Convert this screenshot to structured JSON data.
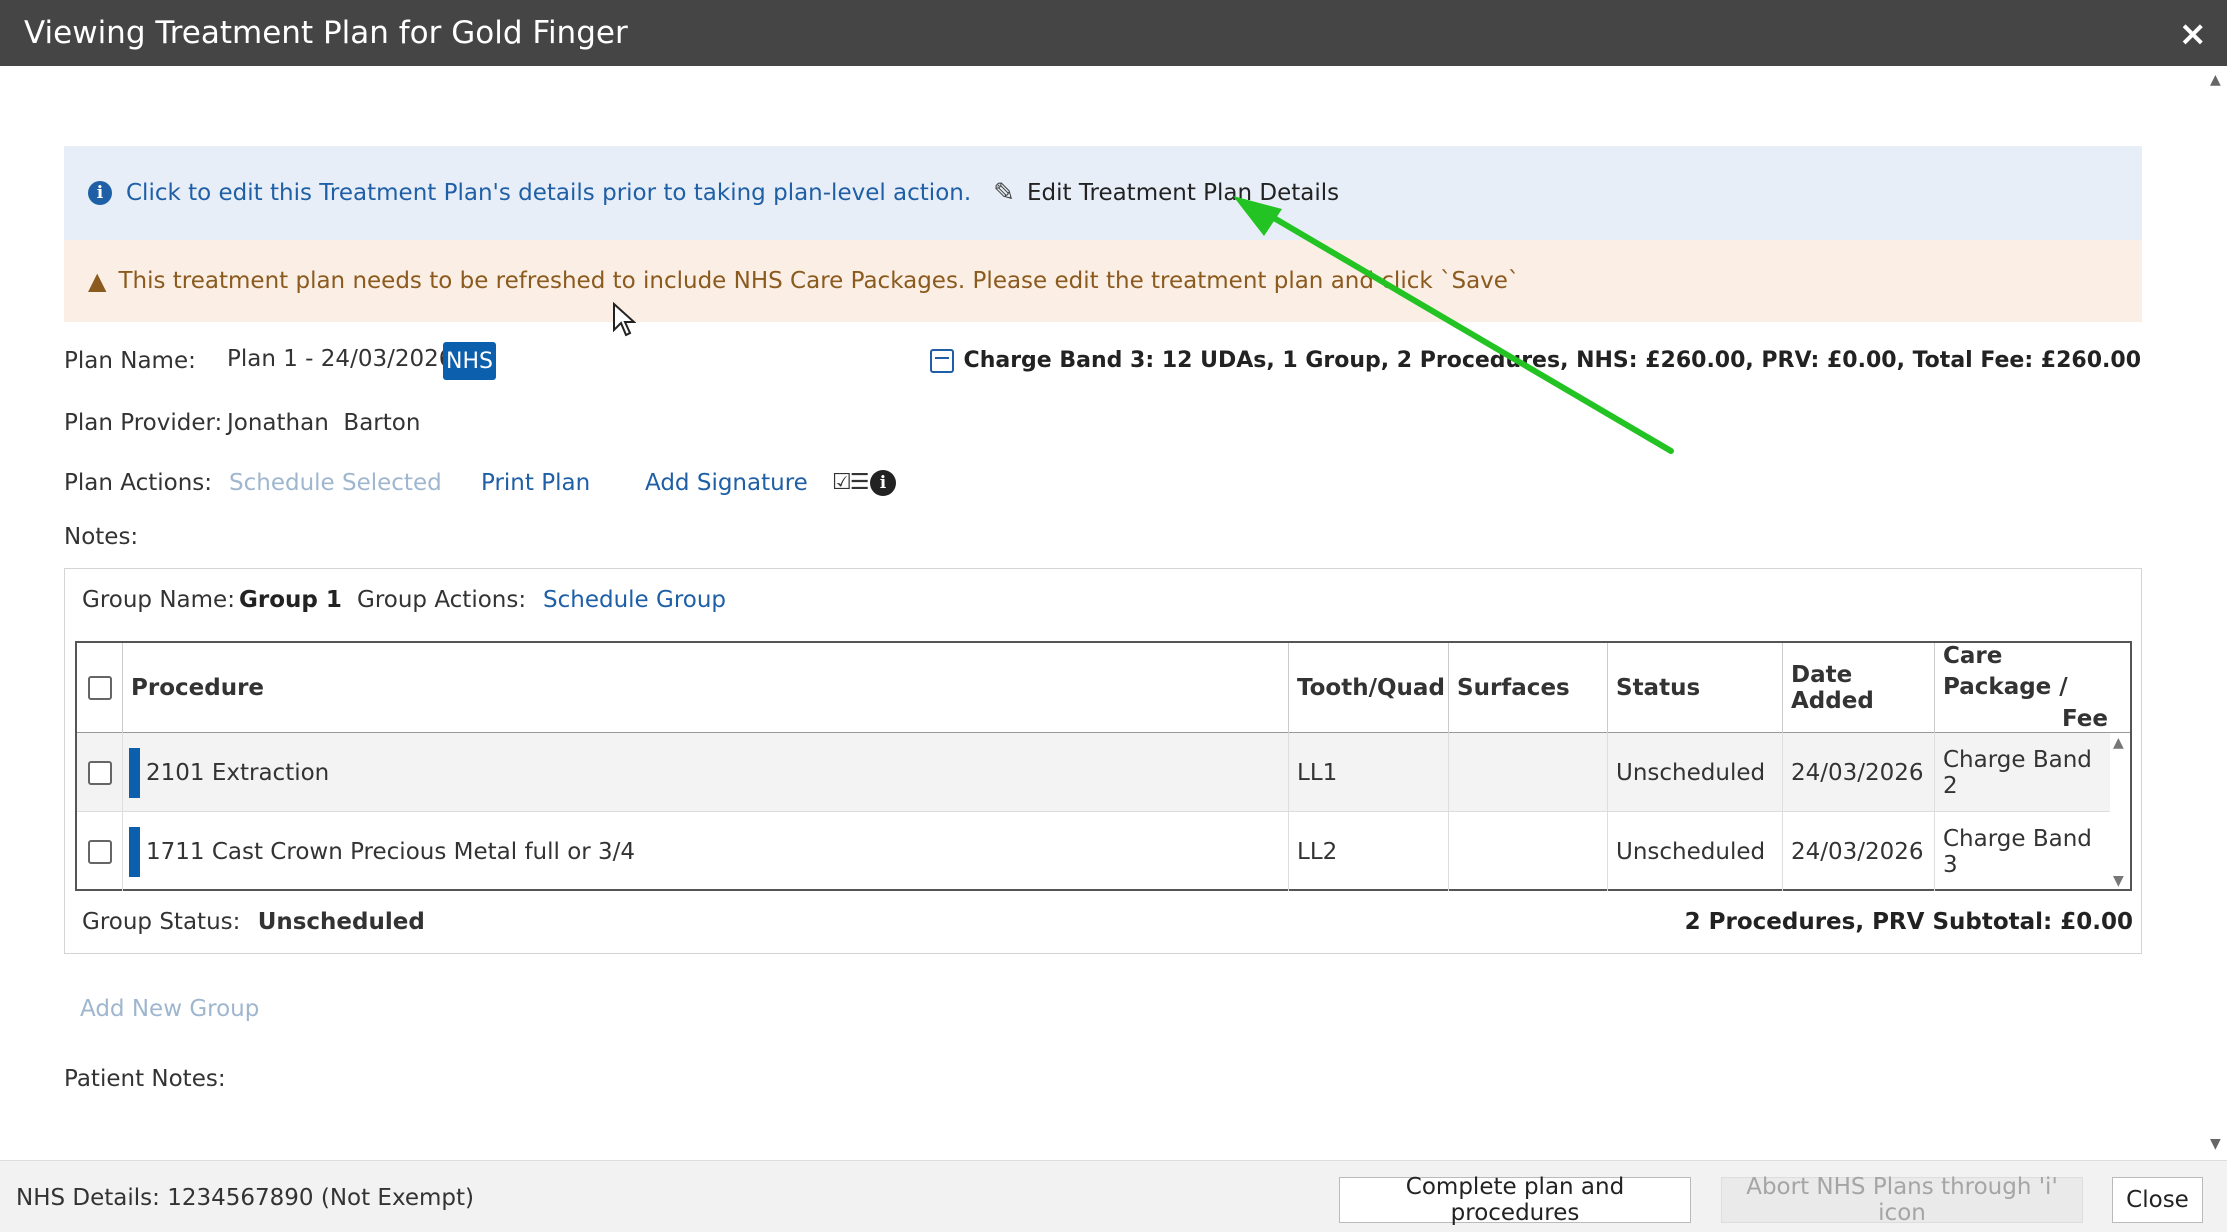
{
  "window": {
    "title": "Viewing Treatment Plan for Gold Finger",
    "close_glyph": "×"
  },
  "info_banner": {
    "text": "Click to edit this Treatment Plan's details prior to taking plan-level action.",
    "edit_link": "Edit Treatment Plan Details"
  },
  "warning_banner": {
    "text": "This treatment plan needs to be refreshed to include NHS Care Packages. Please edit the treatment plan and click `Save`"
  },
  "plan": {
    "name_label": "Plan Name:",
    "name_value": "Plan 1 - 24/03/2026",
    "badge": "NHS",
    "provider_label": "Plan Provider:",
    "provider_value": "Jonathan  Barton",
    "actions_label": "Plan Actions:",
    "actions": {
      "schedule_selected": "Schedule Selected",
      "print_plan": "Print Plan",
      "add_signature": "Add Signature"
    },
    "notes_label": "Notes:",
    "charge_summary": "Charge Band 3: 12 UDAs, 1 Group, 2 Procedures, NHS: £260.00, PRV: £0.00, Total Fee: £260.00"
  },
  "group": {
    "name_label": "Group Name:",
    "name_value": "Group 1",
    "actions_label": "Group Actions:",
    "schedule_group": "Schedule Group",
    "status_label": "Group Status:",
    "status_value": "Unscheduled",
    "subtotal": "2 Procedures, PRV Subtotal: £0.00",
    "columns": {
      "procedure": "Procedure",
      "tooth": "Tooth/Quad",
      "surfaces": "Surfaces",
      "status": "Status",
      "date_added": "Date Added",
      "care_package_1": "Care Package /",
      "care_package_2": "Fee"
    },
    "rows": [
      {
        "procedure": "2101 Extraction",
        "tooth": "LL1",
        "surfaces": "",
        "status": "Unscheduled",
        "date_added": "24/03/2026",
        "care_package": "Charge Band 2"
      },
      {
        "procedure": "1711 Cast Crown Precious Metal full or 3/4",
        "tooth": "LL2",
        "surfaces": "",
        "status": "Unscheduled",
        "date_added": "24/03/2026",
        "care_package": "Charge Band 3"
      }
    ]
  },
  "add_new_group": "Add New Group",
  "patient_notes_label": "Patient Notes:",
  "footer": {
    "nhs_details": "NHS Details: 1234567890 (Not Exempt)",
    "complete_button": "Complete plan and procedures",
    "abort_button": "Abort NHS Plans through 'i' icon",
    "close_button": "Close"
  },
  "colors": {
    "titlebar": "#454545",
    "accent_blue": "#1f5fa6",
    "nhs_badge": "#0b5fad",
    "info_bg": "#e7eef8",
    "warning_bg": "#fbeee4",
    "annotation_arrow": "#22c322"
  }
}
